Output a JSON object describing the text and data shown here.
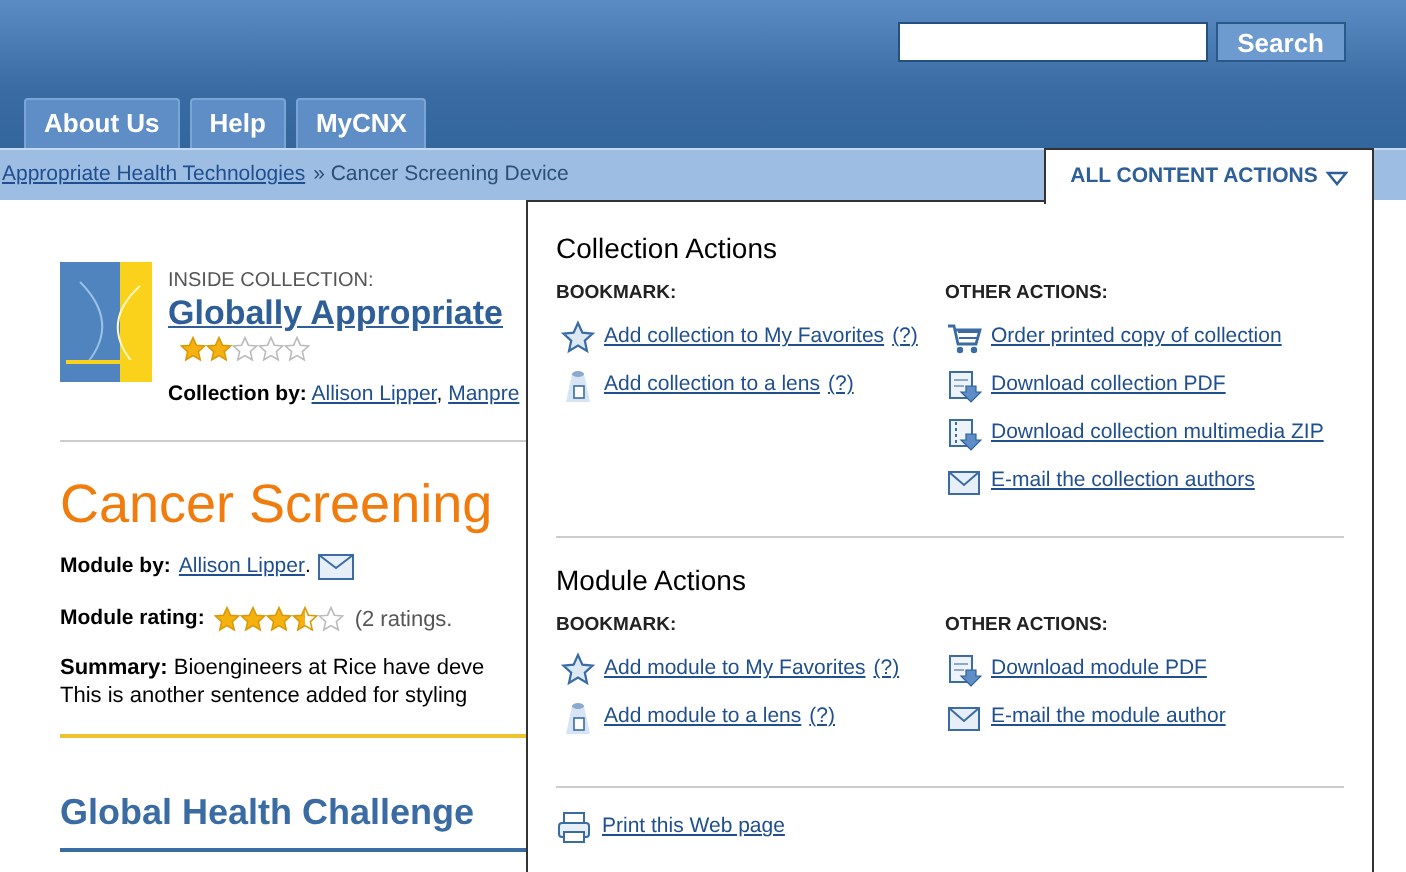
{
  "header": {
    "search": {
      "button": "Search"
    },
    "tabs": [
      {
        "label": "About Us",
        "selected": false
      },
      {
        "label": "Help",
        "selected": false
      },
      {
        "label": "MyCNX",
        "selected": false
      }
    ]
  },
  "breadcrumb": [
    {
      "kind": "link",
      "label": "Appropriate Health Technologies"
    },
    {
      "kind": "text",
      "label": "» Cancer Screening Device"
    }
  ],
  "collection": {
    "eyebrow": "INSIDE COLLECTION:",
    "title": "Globally Appropriate",
    "stars": 2,
    "by_label": "Collection by:",
    "authors": [
      "Allison Lipper",
      "Manpre"
    ],
    "author_separator": ","
  },
  "module": {
    "title": "Cancer Screening",
    "by_label": "Module by:",
    "author": "Allison Lipper",
    "author_end": ".",
    "rating_label": "Module rating:",
    "stars": 3.5,
    "rating_count": "(2 ratings.",
    "summary_label": "Summary:",
    "summary_lines": [
      "Bioengineers at Rice have deve",
      "This is another sentence added for styling"
    ]
  },
  "section_heading": "Global Health Challenge",
  "actions_menu": {
    "label": "ALL CONTENT ACTIONS",
    "expanded": true,
    "sections": [
      {
        "title": "Collection Actions",
        "groups": [
          {
            "heading": "BOOKMARK:",
            "items": [
              {
                "kind": "star",
                "label": "Add collection to My Favorites",
                "help": "(?)"
              },
              {
                "kind": "lens",
                "label": "Add collection to a lens",
                "help": "(?)"
              }
            ]
          },
          {
            "heading": "OTHER ACTIONS:",
            "items": [
              {
                "kind": "cart",
                "label": "Order printed copy of collection"
              },
              {
                "kind": "pdf",
                "label": "Download collection PDF"
              },
              {
                "kind": "zip",
                "label": "Download collection multimedia ZIP"
              },
              {
                "kind": "mail",
                "label": "E-mail the collection authors"
              }
            ]
          }
        ]
      },
      {
        "title": "Module Actions",
        "groups": [
          {
            "heading": "BOOKMARK:",
            "items": [
              {
                "kind": "star",
                "label": "Add module to My Favorites",
                "help": "(?)"
              },
              {
                "kind": "lens",
                "label": "Add module to a lens",
                "help": "(?)"
              }
            ]
          },
          {
            "heading": "OTHER ACTIONS:",
            "items": [
              {
                "kind": "pdf",
                "label": "Download module PDF"
              },
              {
                "kind": "mail",
                "label": "E-mail the module author"
              }
            ]
          }
        ]
      }
    ],
    "print": {
      "label": "Print this Web page"
    }
  }
}
